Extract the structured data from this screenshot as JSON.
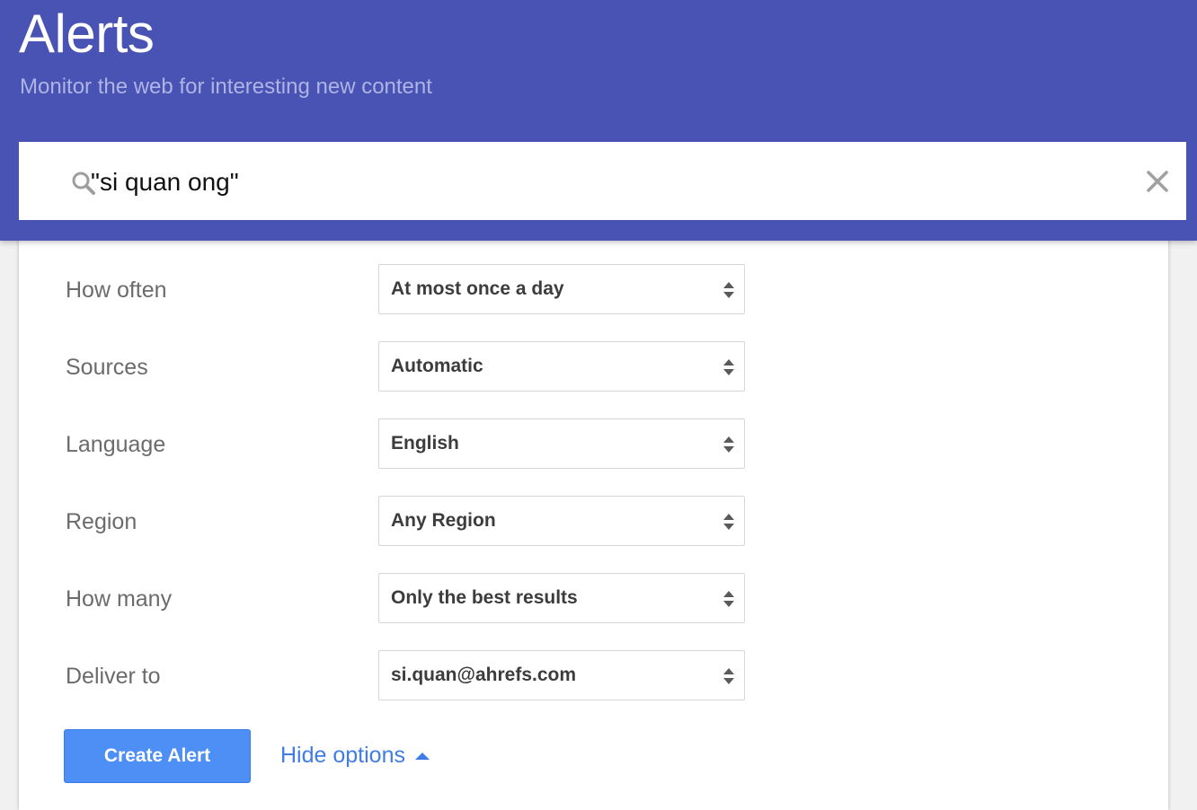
{
  "header": {
    "title": "Alerts",
    "subtitle": "Monitor the web for interesting new content",
    "background_color": "#4853b4"
  },
  "search": {
    "value": "\"si quan ong\"",
    "icon": "search-icon",
    "clear_icon": "close-icon"
  },
  "options": [
    {
      "label": "How often",
      "value": "At most once a day"
    },
    {
      "label": "Sources",
      "value": "Automatic"
    },
    {
      "label": "Language",
      "value": "English"
    },
    {
      "label": "Region",
      "value": "Any Region"
    },
    {
      "label": "How many",
      "value": "Only the best results"
    },
    {
      "label": "Deliver to",
      "value": "si.quan@ahrefs.com"
    }
  ],
  "actions": {
    "create_label": "Create Alert",
    "hide_options_label": "Hide options",
    "accent_color": "#4d8ff5",
    "link_color": "#3f7ce6"
  }
}
